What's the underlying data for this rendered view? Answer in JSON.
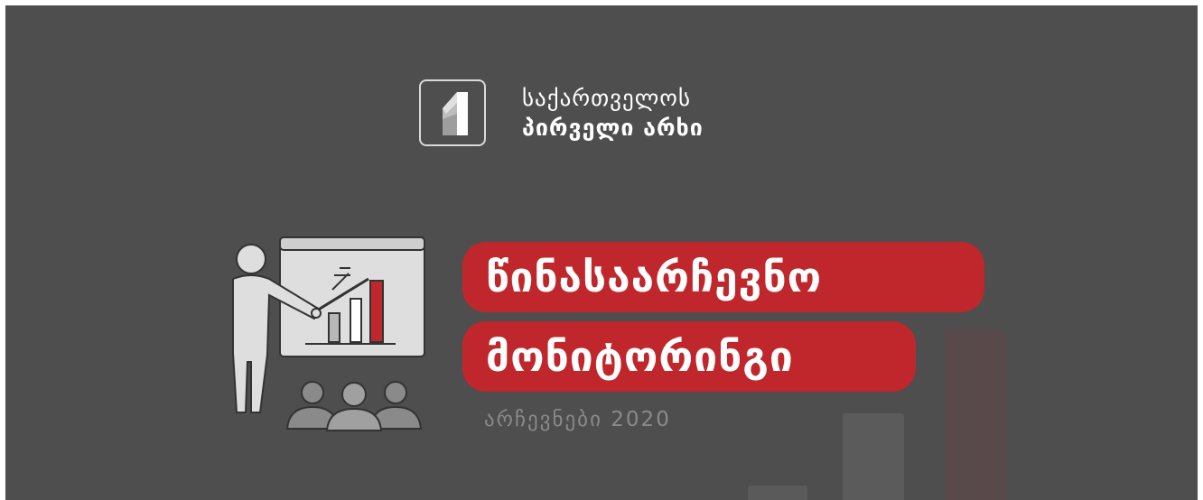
{
  "logo": {
    "line1": "საქართველოს",
    "line2": "პირველი არხი"
  },
  "title": {
    "line1": "წინასაარჩევნო",
    "line2": "მონიტორინგი"
  },
  "subtitle": "არჩევნები 2020",
  "colors": {
    "background": "#4e4e4e",
    "accent": "#c0272d",
    "text": "#ffffff",
    "subtitle": "#8a8a8a"
  },
  "icons": [
    "channel-logo-icon",
    "presenter-with-chart-icon",
    "audience-icon"
  ]
}
